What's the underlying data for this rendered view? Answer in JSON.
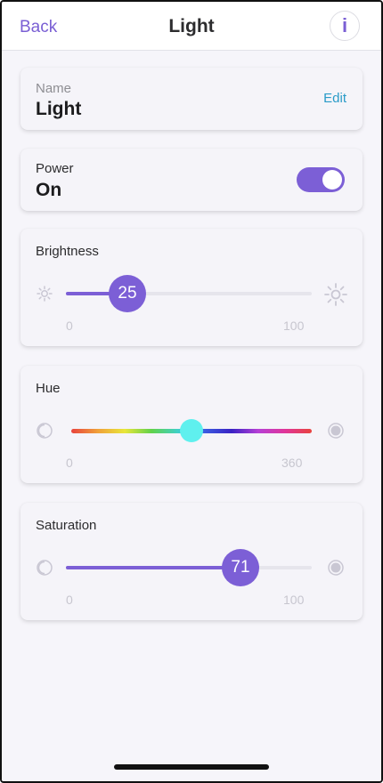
{
  "nav": {
    "back_label": "Back",
    "title": "Light",
    "info_label": "i"
  },
  "name_card": {
    "label": "Name",
    "value": "Light",
    "edit_label": "Edit"
  },
  "power_card": {
    "label": "Power",
    "value": "On",
    "toggle_on": true
  },
  "brightness": {
    "label": "Brightness",
    "value": "25",
    "min": "0",
    "max": "100",
    "fraction": 0.25,
    "min_icon": "sun-small-icon",
    "max_icon": "sun-large-icon"
  },
  "hue": {
    "label": "Hue",
    "value": 180,
    "min": "0",
    "max": "360",
    "fraction": 0.5,
    "thumb_color": "#5ff0ee",
    "min_icon": "half-circle-outline-icon",
    "max_icon": "filled-circle-icon"
  },
  "saturation": {
    "label": "Saturation",
    "value": "71",
    "min": "0",
    "max": "100",
    "fraction": 0.71,
    "min_icon": "half-circle-outline-icon",
    "max_icon": "filled-circle-icon"
  },
  "colors": {
    "accent": "#7c5fd6",
    "link": "#2a9bc8",
    "background": "#f6f5fa"
  }
}
